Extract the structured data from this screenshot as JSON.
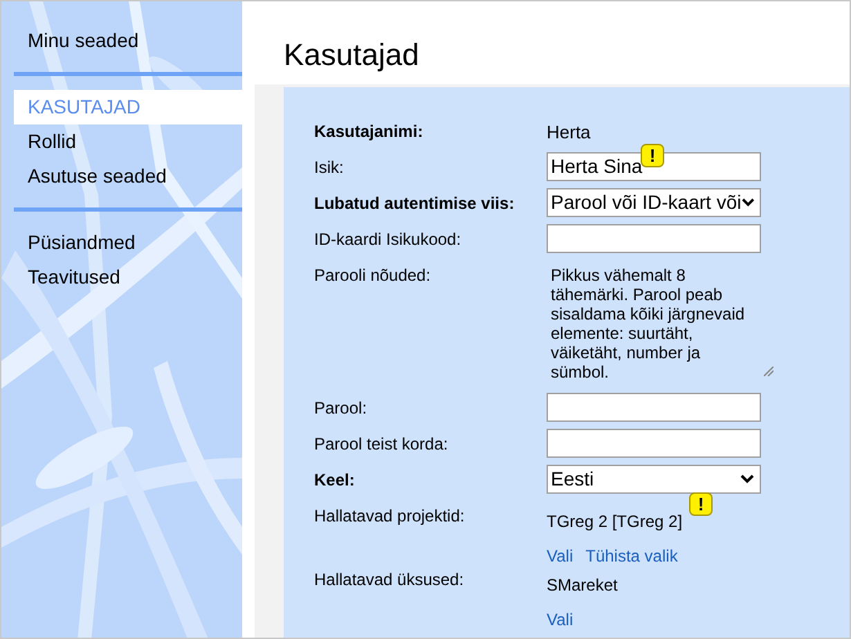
{
  "sidebar": {
    "sections": [
      {
        "items": [
          {
            "label": "Minu seaded",
            "selected": false
          }
        ]
      },
      {
        "items": [
          {
            "label": "KASUTAJAD",
            "selected": true
          },
          {
            "label": "Rollid",
            "selected": false
          },
          {
            "label": "Asutuse seaded",
            "selected": false
          }
        ]
      },
      {
        "items": [
          {
            "label": "Püsiandmed",
            "selected": false
          },
          {
            "label": "Teavitused",
            "selected": false
          }
        ]
      }
    ]
  },
  "page_title": "Kasutajad",
  "form": {
    "rows": [
      {
        "kind": "text",
        "label": "Kasutajanimi:",
        "bold": true,
        "value": "Herta"
      },
      {
        "kind": "input",
        "label": "Isik:",
        "bold": false,
        "value": "Herta Sina",
        "warning": "!"
      },
      {
        "kind": "select",
        "label": "Lubatud autentimise viis:",
        "bold": true,
        "value": "Parool või ID-kaart või"
      },
      {
        "kind": "input",
        "label": "ID-kaardi Isikukood:",
        "bold": false
      },
      {
        "kind": "textarea",
        "label": "Parooli nõuded:",
        "bold": false,
        "value": "Pikkus vähemalt 8 tähemärki. Parool peab sisaldama kõiki järgnevaid elemente: suurtäht, väiketäht, number ja sümbol."
      },
      {
        "kind": "input",
        "label": "Parool:",
        "bold": false
      },
      {
        "kind": "input",
        "label": "Parool teist korda:",
        "bold": false
      },
      {
        "kind": "select",
        "label": "Keel:",
        "bold": true,
        "value": "Eesti"
      },
      {
        "kind": "list",
        "label": "Hallatavad projektid:",
        "bold": false,
        "value": "TGreg 2 [TGreg 2]",
        "warning": "!",
        "links": [
          "Vali",
          "Tühista valik"
        ]
      },
      {
        "kind": "list",
        "label": "Hallatavad üksused:",
        "bold": false,
        "value": "SMareket",
        "links": [
          "Vali"
        ]
      }
    ]
  }
}
